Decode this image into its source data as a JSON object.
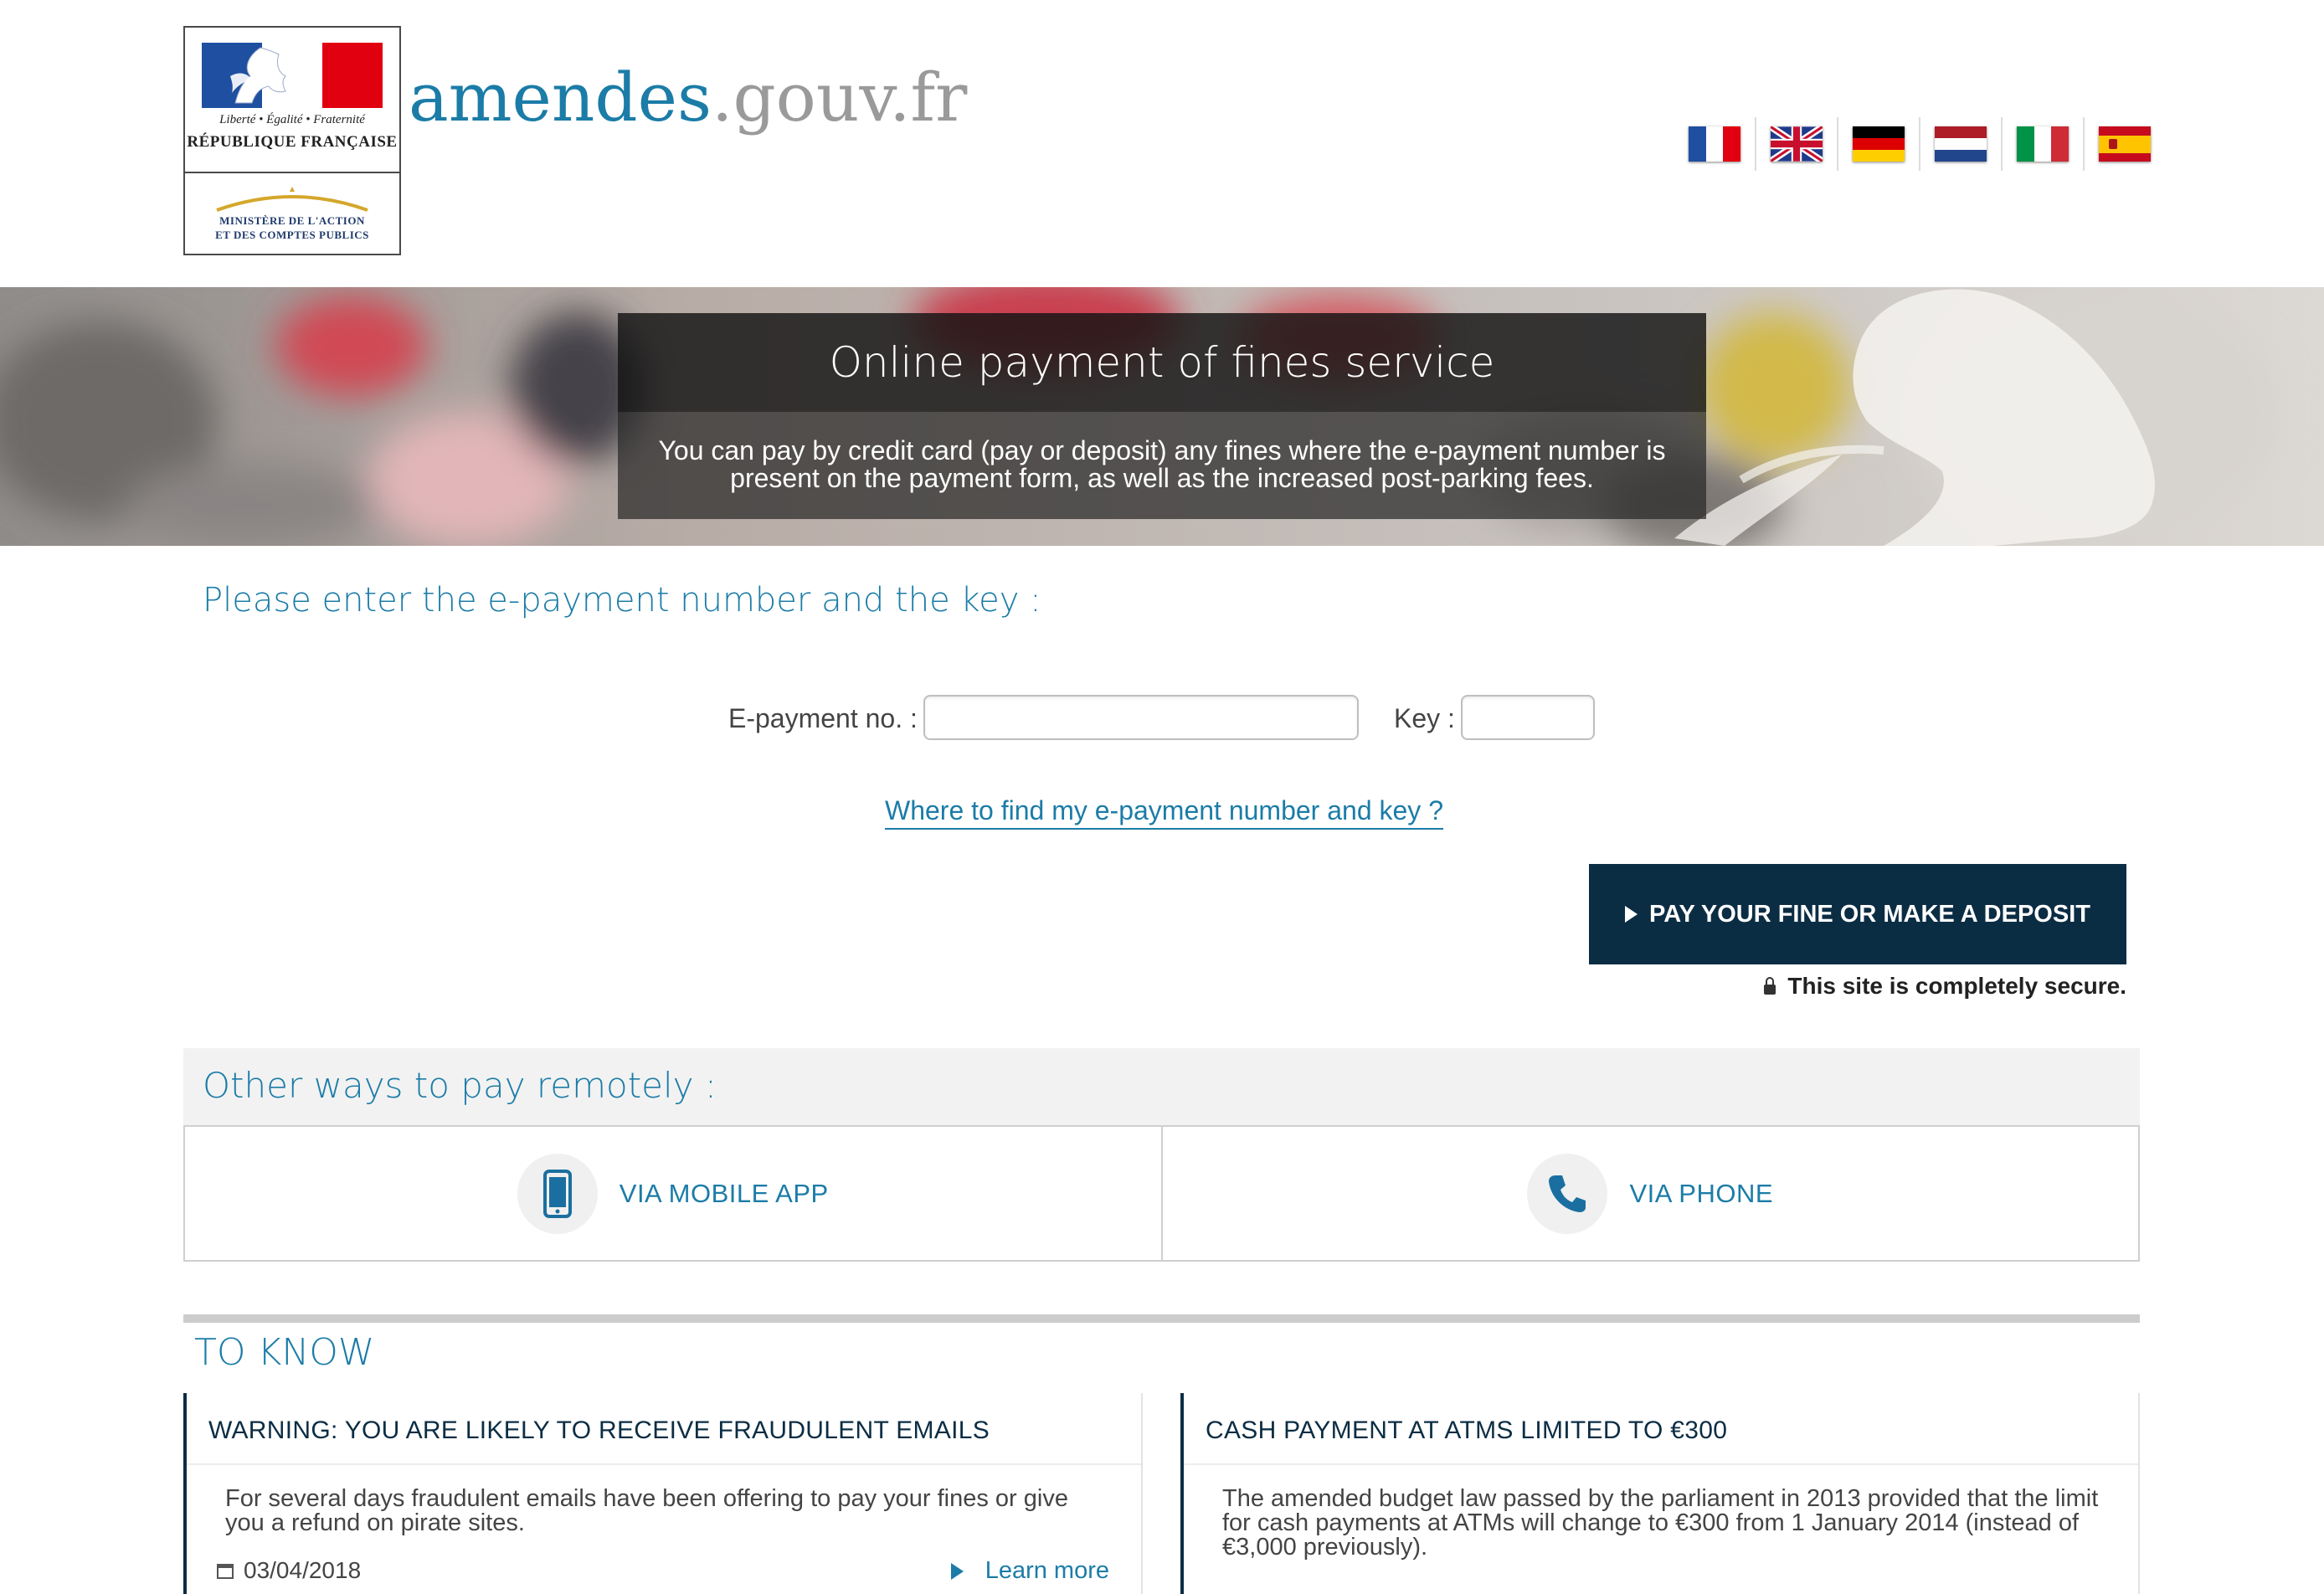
{
  "header": {
    "logo": {
      "motto": "Liberté • Égalité • Fraternité",
      "republic": "RÉPUBLIQUE FRANÇAISE",
      "ministry_line1": "MINISTÈRE DE L'ACTION",
      "ministry_line2": "ET DES COMPTES PUBLICS"
    },
    "site_name_part1": "amendes",
    "site_name_part2": ".gouv.fr",
    "languages": [
      {
        "code": "fr",
        "icon": "flag-france-icon"
      },
      {
        "code": "en",
        "icon": "flag-uk-icon"
      },
      {
        "code": "de",
        "icon": "flag-germany-icon"
      },
      {
        "code": "nl",
        "icon": "flag-netherlands-icon"
      },
      {
        "code": "it",
        "icon": "flag-italy-icon"
      },
      {
        "code": "es",
        "icon": "flag-spain-icon"
      }
    ]
  },
  "banner": {
    "title": "Online payment of fines service",
    "description": "You can pay by credit card (pay or deposit) any fines where the e-payment number is present on the payment form, as well as the increased post-parking fees."
  },
  "form": {
    "heading": "Please enter the e-payment number and the key :",
    "epayment_label": "E-payment no. :",
    "epayment_value": "",
    "key_label": "Key :",
    "key_value": "",
    "help_link": "Where to find my e-payment number and key ?",
    "submit_label": "PAY YOUR FINE OR MAKE A DEPOSIT",
    "secure_text": "This site is completely secure."
  },
  "other_ways": {
    "title": "Other ways to pay remotely :",
    "options": [
      {
        "label": "VIA MOBILE APP",
        "icon": "mobile-phone-icon"
      },
      {
        "label": "VIA PHONE",
        "icon": "phone-handset-icon"
      }
    ]
  },
  "to_know": {
    "title": "TO KNOW",
    "items": [
      {
        "title": "WARNING: YOU ARE LIKELY TO RECEIVE FRAUDULENT EMAILS",
        "text": "For several days fraudulent emails have been offering to pay your fines or give you a refund on pirate sites.",
        "date": "03/04/2018",
        "more": "Learn more"
      },
      {
        "title": "CASH PAYMENT AT ATMS LIMITED TO €300",
        "text": "The amended budget law passed by the parliament in 2013 provided that the limit for cash payments at ATMs will change to €300 from 1 January 2014 (instead of €3,000 previously)."
      }
    ]
  },
  "colors": {
    "brand_blue": "#1b7ca7",
    "dark_navy": "#0b2d44",
    "flag_blue": "#1f4fa0",
    "flag_red": "#e1000f"
  }
}
